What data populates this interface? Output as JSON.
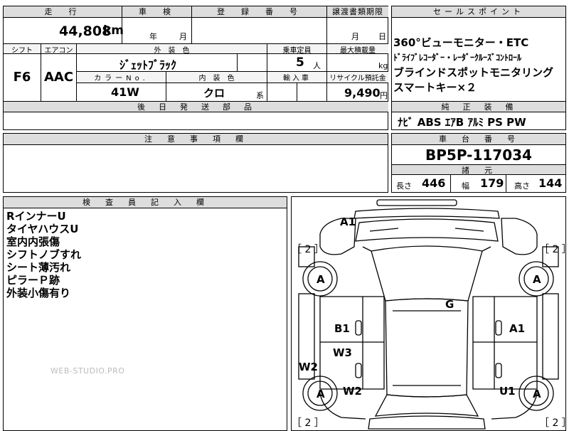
{
  "header": {
    "mileage_label": "走　行",
    "inspection_label": "車　検",
    "registration_label": "登　録　番　号",
    "transfer_deadline_label": "譲渡書類期限",
    "sales_points_label": "セールスポイント"
  },
  "values": {
    "mileage": "44,808",
    "mileage_unit": "km",
    "inspection_year_unit": "年",
    "inspection_month_unit": "月",
    "transfer_month_unit": "月",
    "transfer_day_unit": "日"
  },
  "specs": {
    "shift_label": "シフト",
    "aircon_label": "エアコン",
    "exterior_color_label": "外　装　色",
    "capacity_label": "乗車定員",
    "max_load_label": "最大積載量",
    "shift": "F6",
    "aircon": "AAC",
    "exterior_color": "ｼﾞｪｯﾄﾌﾞﾗｯｸ",
    "capacity": "5",
    "capacity_unit": "人",
    "max_load_unit": "kg",
    "color_no_label": "カラーNo.",
    "interior_color_label": "内　装　色",
    "import_label": "輸入車",
    "recycle_label": "リサイクル預託金",
    "color_no": "41W",
    "interior_color": "クロ",
    "interior_suffix": "系",
    "recycle_fee": "9,490",
    "recycle_unit": "円",
    "later_parts_label": "後　日　発　送　部　品"
  },
  "sales_points": [
    "360°ビューモニター・ETC",
    "ﾄﾞﾗｲﾌﾞﾚｺｰﾀﾞｰ・ﾚｰﾀﾞｰｸﾙｰｽﾞｺﾝﾄﾛｰﾙ",
    "ブラインドスポットモニタリング",
    "スマートキー×２"
  ],
  "equipment": {
    "label": "純　正　装　備",
    "items": "ﾅﾋﾞ ABS ｴｱB ｱﾙﾐ PS PW"
  },
  "notes": {
    "label": "注　意　事　項　欄"
  },
  "chassis": {
    "label": "車　台　番　号",
    "number": "BP5P-117034",
    "dimensions_label": "諸　元",
    "length_label": "長さ",
    "length": "446",
    "width_label": "幅",
    "width": "179",
    "height_label": "高さ",
    "height": "144"
  },
  "inspector": {
    "label": "検　査　員　記　入　欄",
    "remarks": [
      "RインナーU",
      "タイヤハウスU",
      "室内内張傷",
      "シフトノブすれ",
      "シート薄汚れ",
      "ピラーＰ跡",
      "外装小傷有り"
    ],
    "watermark": "WEB-STUDIO.PRO"
  },
  "diagram": {
    "marks": {
      "a1_top": "A1",
      "g": "G",
      "b1": "B1",
      "a1_right": "A1",
      "w3": "W3",
      "w2_left": "W2",
      "w2_inner": "W2",
      "u1": "U1",
      "tire": "A",
      "tire_count": "［ 2 ］"
    }
  }
}
